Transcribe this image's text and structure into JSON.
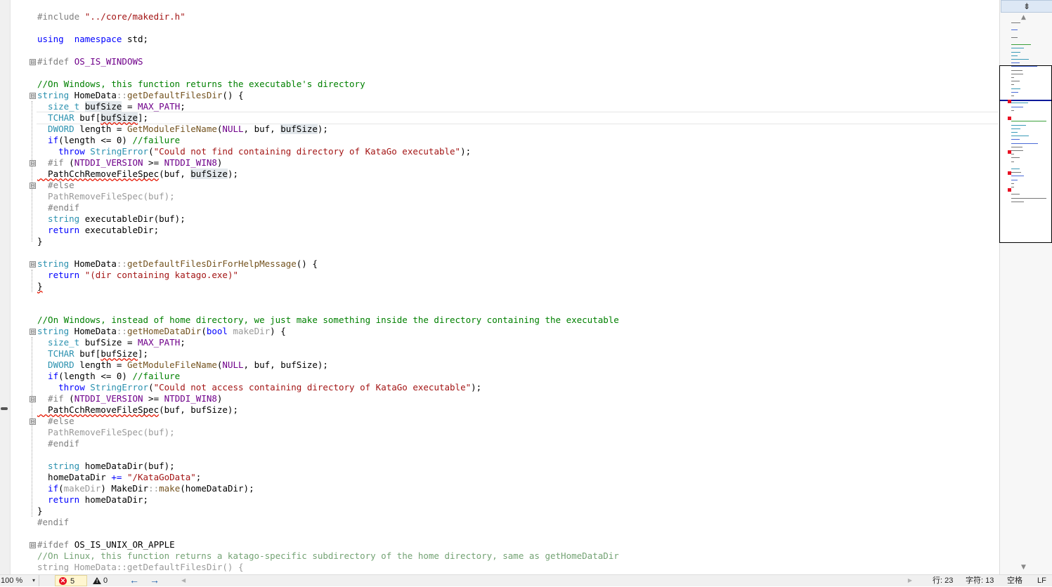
{
  "editor": {
    "lines": [
      [
        [
          "pp",
          "#include "
        ],
        [
          "str",
          "\"../core/makedir.h\""
        ]
      ],
      [],
      [
        [
          "kw",
          "using"
        ],
        [
          "",
          "  "
        ],
        [
          "kw",
          "namespace"
        ],
        [
          "",
          " std;"
        ]
      ],
      [],
      [
        [
          "pp",
          "#ifdef "
        ],
        [
          "mac",
          "OS_IS_WINDOWS"
        ]
      ],
      [],
      [
        [
          "com",
          "//On Windows, this function returns the executable's directory"
        ]
      ],
      [
        [
          "ty",
          "string"
        ],
        [
          "",
          " HomeData"
        ],
        [
          "dim",
          "::"
        ],
        [
          "fn",
          "getDefaultFilesDir"
        ],
        [
          "",
          "() {"
        ]
      ],
      [
        [
          "ty",
          "  size_t"
        ],
        [
          "",
          " "
        ],
        [
          "hl",
          "bufSize"
        ],
        [
          "",
          " = "
        ],
        [
          "mac",
          "MAX_PATH"
        ],
        [
          "",
          ";"
        ]
      ],
      [
        [
          "ty",
          "  TCHAR"
        ],
        [
          "",
          " buf["
        ],
        [
          "sqhl",
          "bufSize"
        ],
        [
          "",
          "];"
        ]
      ],
      [
        [
          "ty",
          "  DWORD"
        ],
        [
          "",
          " length = "
        ],
        [
          "fn",
          "GetModuleFileName"
        ],
        [
          "",
          "("
        ],
        [
          "mac",
          "NULL"
        ],
        [
          "",
          ", buf, "
        ],
        [
          "hl",
          "bufSize"
        ],
        [
          "",
          ");"
        ]
      ],
      [
        [
          "kw",
          "  if"
        ],
        [
          "",
          "(length <= 0) "
        ],
        [
          "com",
          "//failure"
        ]
      ],
      [
        [
          "kw",
          "    throw"
        ],
        [
          "",
          " "
        ],
        [
          "ty",
          "StringError"
        ],
        [
          "",
          "("
        ],
        [
          "str",
          "\"Could not find containing directory of KataGo executable\""
        ],
        [
          "",
          ");"
        ]
      ],
      [
        [
          "pp",
          "  #if "
        ],
        [
          "",
          "("
        ],
        [
          "mac",
          "NTDDI_VERSION"
        ],
        [
          "",
          " >= "
        ],
        [
          "mac",
          "NTDDI_WIN8"
        ],
        [
          "",
          ")"
        ]
      ],
      [
        [
          "sq",
          "  PathCchRemoveFileSpec"
        ],
        [
          "",
          "(buf, "
        ],
        [
          "hl",
          "bufSize"
        ],
        [
          "",
          ");"
        ]
      ],
      [
        [
          "pp",
          "  #else"
        ]
      ],
      [
        [
          "dim",
          "  PathRemoveFileSpec(buf);"
        ]
      ],
      [
        [
          "pp",
          "  #endif"
        ]
      ],
      [
        [
          "ty",
          "  string"
        ],
        [
          "",
          " executableDir(buf);"
        ]
      ],
      [
        [
          "kw",
          "  return"
        ],
        [
          "",
          " executableDir;"
        ]
      ],
      [
        [
          "",
          "}"
        ]
      ],
      [],
      [
        [
          "ty",
          "string"
        ],
        [
          "",
          " HomeData"
        ],
        [
          "dim",
          "::"
        ],
        [
          "fn",
          "getDefaultFilesDirForHelpMessage"
        ],
        [
          "",
          "() {"
        ]
      ],
      [
        [
          "kw",
          "  return"
        ],
        [
          "",
          " "
        ],
        [
          "str",
          "\"(dir containing katago.exe)\""
        ]
      ],
      [
        [
          "sq",
          "}"
        ]
      ],
      [],
      [],
      [
        [
          "com",
          "//On Windows, instead of home directory, we just make something inside the directory containing the executable"
        ]
      ],
      [
        [
          "ty",
          "string"
        ],
        [
          "",
          " HomeData"
        ],
        [
          "dim",
          "::"
        ],
        [
          "fn",
          "getHomeDataDir"
        ],
        [
          "",
          "("
        ],
        [
          "kw",
          "bool"
        ],
        [
          "",
          " "
        ],
        [
          "dim",
          "makeDir"
        ],
        [
          "",
          ") {"
        ]
      ],
      [
        [
          "ty",
          "  size_t"
        ],
        [
          "",
          " bufSize = "
        ],
        [
          "mac",
          "MAX_PATH"
        ],
        [
          "",
          ";"
        ]
      ],
      [
        [
          "ty",
          "  TCHAR"
        ],
        [
          "",
          " buf["
        ],
        [
          "sq",
          "bufSize"
        ],
        [
          "",
          "];"
        ]
      ],
      [
        [
          "ty",
          "  DWORD"
        ],
        [
          "",
          " length = "
        ],
        [
          "fn",
          "GetModuleFileName"
        ],
        [
          "",
          "("
        ],
        [
          "mac",
          "NULL"
        ],
        [
          "",
          ", buf, bufSize);"
        ]
      ],
      [
        [
          "kw",
          "  if"
        ],
        [
          "",
          "(length <= 0) "
        ],
        [
          "com",
          "//failure"
        ]
      ],
      [
        [
          "kw",
          "    throw"
        ],
        [
          "",
          " "
        ],
        [
          "ty",
          "StringError"
        ],
        [
          "",
          "("
        ],
        [
          "str",
          "\"Could not access containing directory of KataGo executable\""
        ],
        [
          "",
          ");"
        ]
      ],
      [
        [
          "pp",
          "  #if "
        ],
        [
          "",
          "("
        ],
        [
          "mac",
          "NTDDI_VERSION"
        ],
        [
          "",
          " >= "
        ],
        [
          "mac",
          "NTDDI_WIN8"
        ],
        [
          "",
          ")"
        ]
      ],
      [
        [
          "sq",
          "  PathCchRemoveFileSpec"
        ],
        [
          "",
          "(buf, bufSize);"
        ]
      ],
      [
        [
          "pp",
          "  #else"
        ]
      ],
      [
        [
          "dim",
          "  PathRemoveFileSpec(buf);"
        ]
      ],
      [
        [
          "pp",
          "  #endif"
        ]
      ],
      [],
      [
        [
          "ty",
          "  string"
        ],
        [
          "",
          " homeDataDir(buf);"
        ]
      ],
      [
        [
          "",
          "  homeDataDir "
        ],
        [
          "kw",
          "+="
        ],
        [
          "",
          " "
        ],
        [
          "str",
          "\"/KataGoData\""
        ],
        [
          "",
          ";"
        ]
      ],
      [
        [
          "kw",
          "  if"
        ],
        [
          "",
          "("
        ],
        [
          "dim",
          "makeDir"
        ],
        [
          "",
          ") MakeDir"
        ],
        [
          "dim",
          "::"
        ],
        [
          "fn",
          "make"
        ],
        [
          "",
          "(homeDataDir);"
        ]
      ],
      [
        [
          "kw",
          "  return"
        ],
        [
          "",
          " homeDataDir;"
        ]
      ],
      [
        [
          "",
          "}"
        ]
      ],
      [
        [
          "pp",
          "#endif"
        ]
      ],
      [],
      [
        [
          "pp",
          "#ifdef "
        ],
        [
          "",
          "OS_IS_UNIX_OR_APPLE"
        ]
      ],
      [
        [
          "dimc",
          "//On Linux, this function returns a katago-specific subdirectory of the home directory, same as getHomeDataDir"
        ]
      ],
      [
        [
          "dim",
          "string HomeData::getDefaultFilesDir() {"
        ]
      ]
    ],
    "folds": [
      "⊟",
      "⊟",
      "⊟",
      "⊟",
      "⊟",
      "⊟",
      "⊟",
      "⊟",
      "⊟"
    ]
  },
  "minimap": {
    "split_icon": "⇟",
    "up_icon": "▲",
    "down_icon": "▼"
  },
  "status": {
    "zoom": "100 %",
    "zoom_caret": "▾",
    "errors": "5",
    "error_icon": "✕",
    "warnings": "0",
    "warning_icon": "!",
    "back_icon": "🡐",
    "forward_icon": "🡒",
    "back_arrow": "←",
    "forward_arrow": "→",
    "line": "行: 23",
    "char": "字符: 13",
    "spaces": "空格",
    "eol": "LF"
  },
  "colors": {
    "keyword": "#0000ff",
    "type": "#2b91af",
    "function": "#74531f",
    "macro": "#6f008a",
    "string": "#a31515",
    "comment": "#008000",
    "preprocessor": "#808080",
    "error": "#e81123"
  }
}
